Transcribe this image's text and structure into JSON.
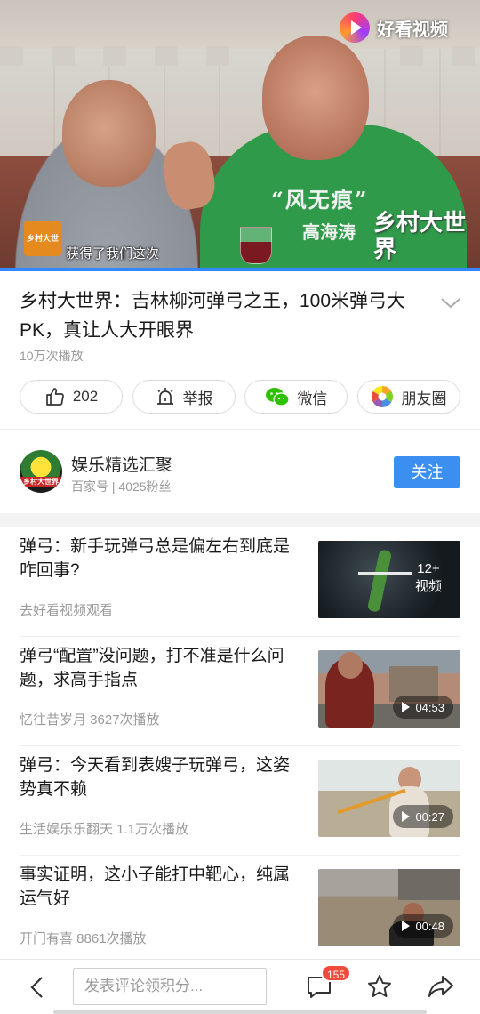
{
  "video": {
    "subtitle": "获得了我们这次",
    "watermark_text": "好看视频",
    "show_logo_text": "乡村大世界",
    "brand_mark": "乡村大世界",
    "shirt_text_line1": "“风无痕”",
    "shirt_text_line2": "高海涛",
    "progress": 1.0
  },
  "article": {
    "title": "乡村大世界：吉林柳河弹弓之王，100米弹弓大PK，真让人大开眼界",
    "plays": "10万次播放"
  },
  "actions": {
    "like_count": "202",
    "report_label": "举报",
    "wechat_label": "微信",
    "moments_label": "朋友圈"
  },
  "author": {
    "avatar_text": "乡村大世界",
    "name": "娱乐精选汇聚",
    "meta": "百家号 | 4025粉丝",
    "follow_label": "关注"
  },
  "related": [
    {
      "title": "弹弓：新手玩弹弓总是偏左右到底是咋回事?",
      "meta": "去好看视频观看",
      "badge": "12+\n视频",
      "duration": ""
    },
    {
      "title": "弹弓“配置”没问题，打不准是什么问题，求高手指点",
      "meta": "忆往昔岁月  3627次播放",
      "badge": "",
      "duration": "04:53"
    },
    {
      "title": "弹弓：今天看到表嫂子玩弹弓，这姿势真不赖",
      "meta": "生活娱乐乐翻天  1.1万次播放",
      "badge": "",
      "duration": "00:27"
    },
    {
      "title": "事实证明，这小子能打中靶心，纯属运气好",
      "meta": "开门有喜  8861次播放",
      "badge": "",
      "duration": "00:48"
    }
  ],
  "bottom_bar": {
    "comment_placeholder": "发表评论领积分...",
    "comment_count": "155"
  },
  "colors": {
    "accent": "#3a8ff0",
    "badge": "#f04a3c",
    "progress": "#3388ff"
  },
  "icons": [
    "chevron-down-icon",
    "thumbs-up-icon",
    "report-icon",
    "wechat-icon",
    "moments-icon",
    "back-icon",
    "comment-icon",
    "star-icon",
    "share-icon",
    "play-icon"
  ]
}
